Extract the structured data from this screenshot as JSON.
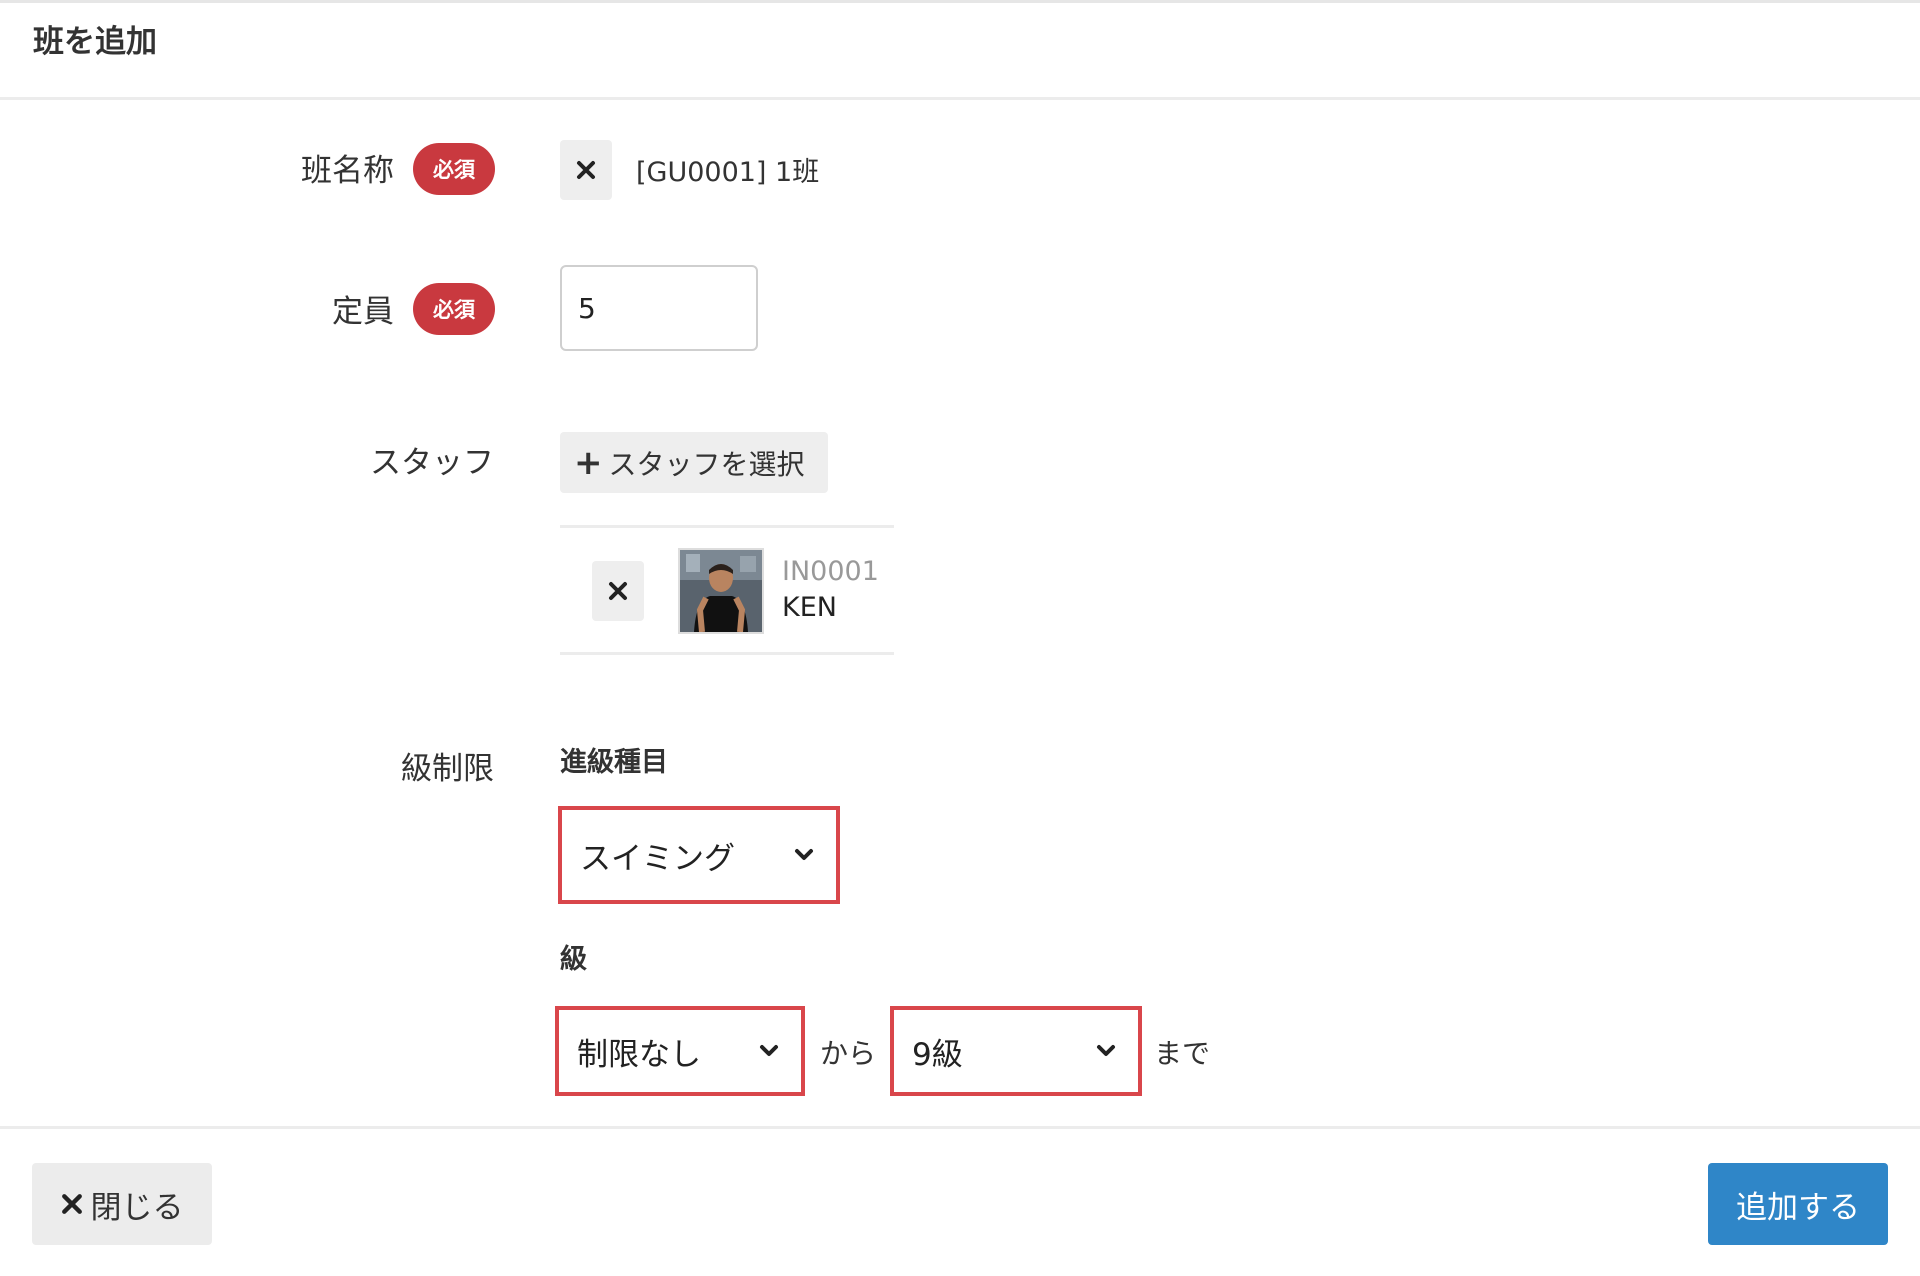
{
  "dialog": {
    "title": "班を追加"
  },
  "form": {
    "group_name": {
      "label": "班名称",
      "required_badge": "必須",
      "value": "[GU0001] 1班",
      "clear_icon": "close-icon"
    },
    "capacity": {
      "label": "定員",
      "required_badge": "必須",
      "value": "5"
    },
    "staff": {
      "label": "スタッフ",
      "select_button": "スタッフを選択",
      "select_icon": "plus-icon",
      "members": [
        {
          "code": "IN0001",
          "name": "KEN",
          "remove_icon": "close-icon"
        }
      ]
    },
    "grade_limit": {
      "label": "級制限",
      "category_label": "進級種目",
      "category_value": "スイミング",
      "grade_label": "級",
      "from_value": "制限なし",
      "from_text": "から",
      "to_value": "9級",
      "to_text": "まで"
    }
  },
  "footer": {
    "close_label": "閉じる",
    "submit_label": "追加する"
  },
  "colors": {
    "required_badge": "#c9393f",
    "highlight_border": "#d9464b",
    "primary_button": "#2f86c8"
  }
}
